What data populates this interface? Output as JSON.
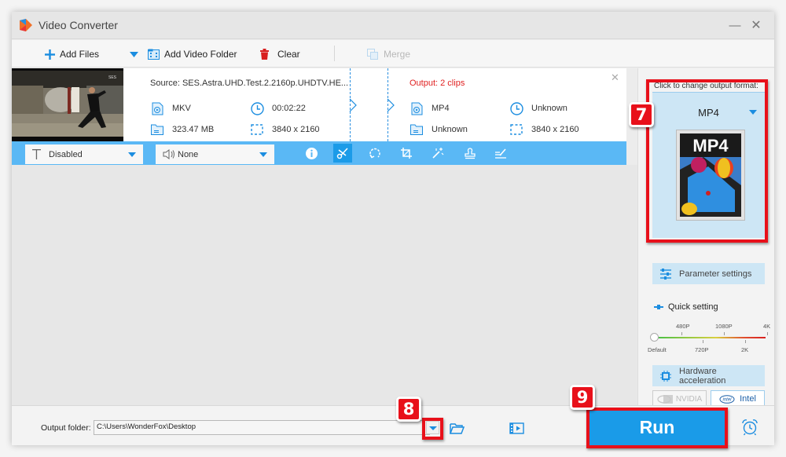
{
  "window": {
    "title": "Video Converter",
    "minimize_glyph": "—",
    "close_glyph": "✕"
  },
  "toolbar": {
    "add_files": "Add Files",
    "add_video_folder": "Add Video Folder",
    "clear": "Clear",
    "merge": "Merge"
  },
  "file": {
    "source_label": "Source: SES.Astra.UHD.Test.2.2160p.UHDTV.HE...",
    "source": {
      "format": "MKV",
      "duration": "00:02:22",
      "size": "323.47 MB",
      "resolution": "3840 x 2160"
    },
    "output_label": "Output: 2 clips",
    "output": {
      "format": "MP4",
      "duration": "Unknown",
      "size": "Unknown",
      "resolution": "3840 x 2160"
    },
    "close_glyph": "✕",
    "subtitle_dropdown": "Disabled",
    "audio_dropdown": "None",
    "thumbnail_watermark": "SES"
  },
  "edit_tools": [
    {
      "name": "info-icon",
      "active": false
    },
    {
      "name": "trim-scissors-icon",
      "active": true
    },
    {
      "name": "rotate-icon",
      "active": false
    },
    {
      "name": "crop-icon",
      "active": false
    },
    {
      "name": "effects-wand-icon",
      "active": false
    },
    {
      "name": "watermark-stamp-icon",
      "active": false
    },
    {
      "name": "subtitle-edit-icon",
      "active": false
    }
  ],
  "side": {
    "format_hint": "Click to change output format:",
    "format_name": "MP4",
    "format_icon_text": "MP4",
    "parameter_settings": "Parameter settings",
    "quick_setting": "Quick setting",
    "quality_levels_top": [
      "480P",
      "1080P",
      "4K"
    ],
    "quality_levels_bottom": [
      "Default",
      "720P",
      "2K"
    ],
    "quality_selected": "Default",
    "hardware_acceleration": "Hardware acceleration",
    "nvidia": "NVIDIA",
    "intel": "Intel"
  },
  "bottom": {
    "output_folder_label": "Output folder:",
    "output_folder_value": "C:\\Users\\WonderFox\\Desktop",
    "run": "Run"
  },
  "annotations": {
    "step_format": "7",
    "step_folder": "8",
    "step_run": "9",
    "highlight_color": "#e8101a"
  },
  "colors": {
    "accent": "#1a9be8",
    "bar_blue": "#5ab8f5",
    "output_red": "#e02020"
  }
}
